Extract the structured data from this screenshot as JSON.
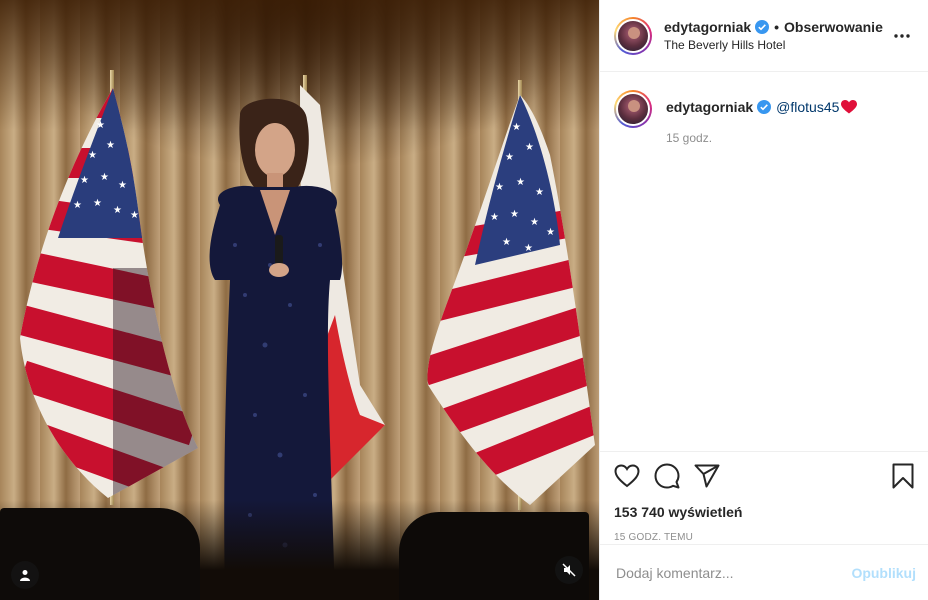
{
  "post": {
    "username": "edytagorniak",
    "follow_separator": "•",
    "follow_status": "Obserwowanie",
    "location": "The Beverly Hills Hotel",
    "more_icon": "more-horizontal-icon",
    "verified_icon": "verified-badge-icon"
  },
  "caption": {
    "username": "edytagorniak",
    "mention": "@flotus45",
    "emoji": "red-heart",
    "time": "15 godz."
  },
  "actions": {
    "like_icon": "heart-outline-icon",
    "comment_icon": "comment-icon",
    "share_icon": "paper-plane-icon",
    "save_icon": "bookmark-icon",
    "views_count": "153 740",
    "views_label": "wyświetleń",
    "timestamp": "15 GODZ. TEMU"
  },
  "comment_box": {
    "placeholder": "Dodaj komentarz...",
    "post_label": "Opublikuj"
  },
  "media": {
    "user_tag_icon": "user-tag-icon",
    "mute_icon": "muted-speaker-icon"
  },
  "colors": {
    "link_blue": "#00376b",
    "verified_blue": "#3897f0",
    "post_button_disabled": "#b2dffc",
    "secondary_text": "#8e8e8e",
    "heart_red": "#e0103a"
  }
}
